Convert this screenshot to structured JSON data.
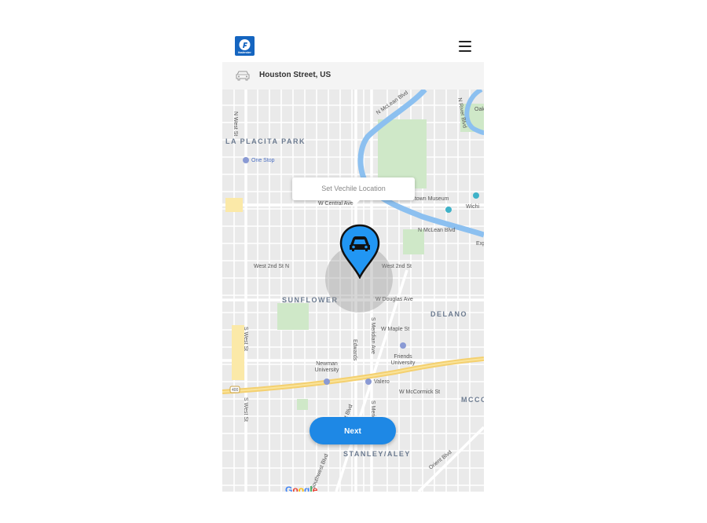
{
  "app": {
    "logo_text": "fastester",
    "menu_icon": "hamburger-icon"
  },
  "address_bar": {
    "vehicle_icon": "car-outline-icon",
    "address": "Houston Street, US"
  },
  "map": {
    "tooltip": "Set Vechile Location",
    "pin_icon": "car-location-pin-icon",
    "pin_color": "#2196f3",
    "districts": [
      "LA PLACITA PARK",
      "SUNFLOWER",
      "DELANO",
      "STANLEY/ALEY",
      "MCCO"
    ],
    "streets": [
      "N West St",
      "N McLean Blvd",
      "N River Blvd",
      "W Central Ave",
      "N McLean Blvd",
      "West 2nd St N",
      "West 2nd St",
      "W Douglas Ave",
      "W Maple St",
      "S West St",
      "Edwards",
      "S Meridian Ave",
      "W McCormick St",
      "Southwest Blvd",
      "S Meridian",
      "S West St",
      "Orient Blvd",
      "Southwest Blvd",
      "400"
    ],
    "pois": [
      "One Stop",
      "Old Cowtown Museum",
      "Wichi",
      "Oak",
      "Exp",
      "Newman University",
      "Friends University",
      "Valero"
    ],
    "attribution": "Google"
  },
  "actions": {
    "next_label": "Next",
    "next_color": "#1e88e5"
  }
}
